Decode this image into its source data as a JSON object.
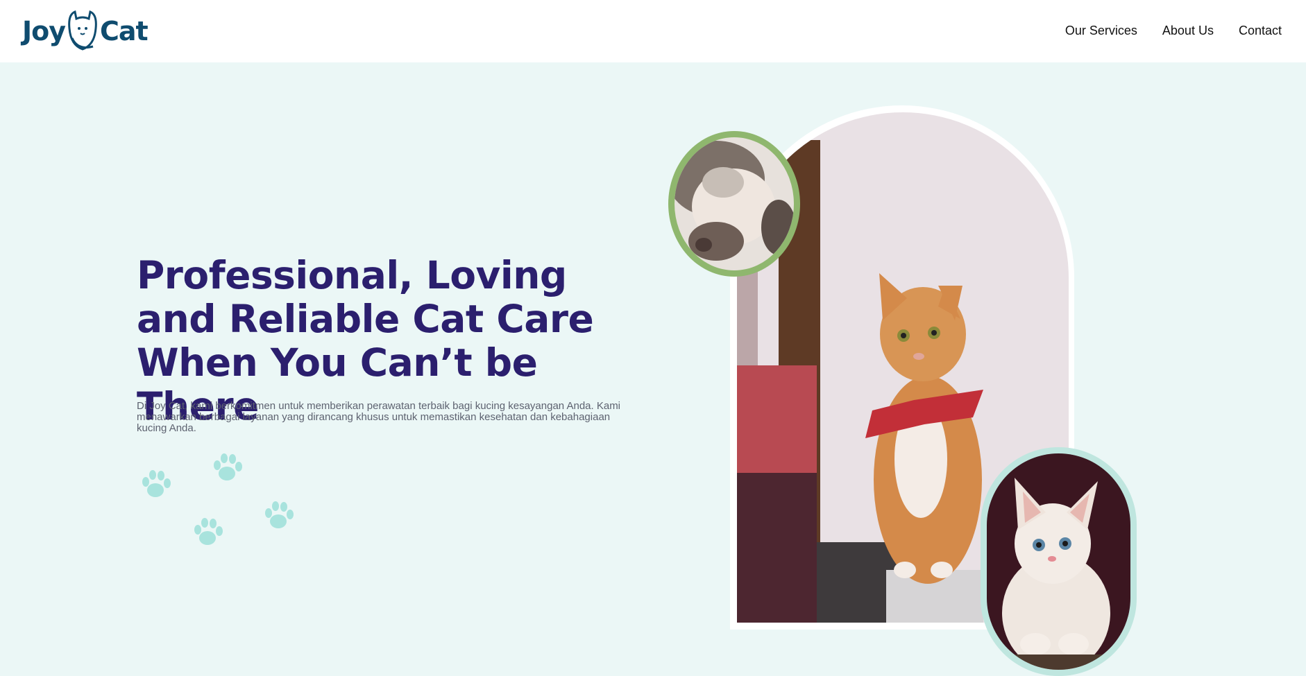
{
  "brand": {
    "name_left": "Joy",
    "name_right": "Cat",
    "primary_color": "#0f4c6f"
  },
  "nav": {
    "items": [
      {
        "label": "Our Services"
      },
      {
        "label": "About Us"
      },
      {
        "label": "Contact"
      }
    ]
  },
  "hero": {
    "headline": "Professional, Loving and Reliable Cat Care When You Can’t be There",
    "description": "Di Joy Cat, kami berkomitmen untuk memberikan perawatan terbaik bagi kucing kesayangan Anda. Kami menawarkan berbagai layanan yang dirancang khusus untuk memastikan kesehatan dan kebahagiaan kucing Anda.",
    "headline_color": "#2b1f6e",
    "background_color": "#ebf7f6",
    "paw_color": "#a8e3dd"
  },
  "images": {
    "main": "orange-cat-with-red-bandana",
    "top_circle": "sleeping-tabby-kitten",
    "bottom_circle": "white-kitten",
    "top_ring_color": "#8fb76e",
    "bottom_ring_color": "#bfe6df"
  }
}
